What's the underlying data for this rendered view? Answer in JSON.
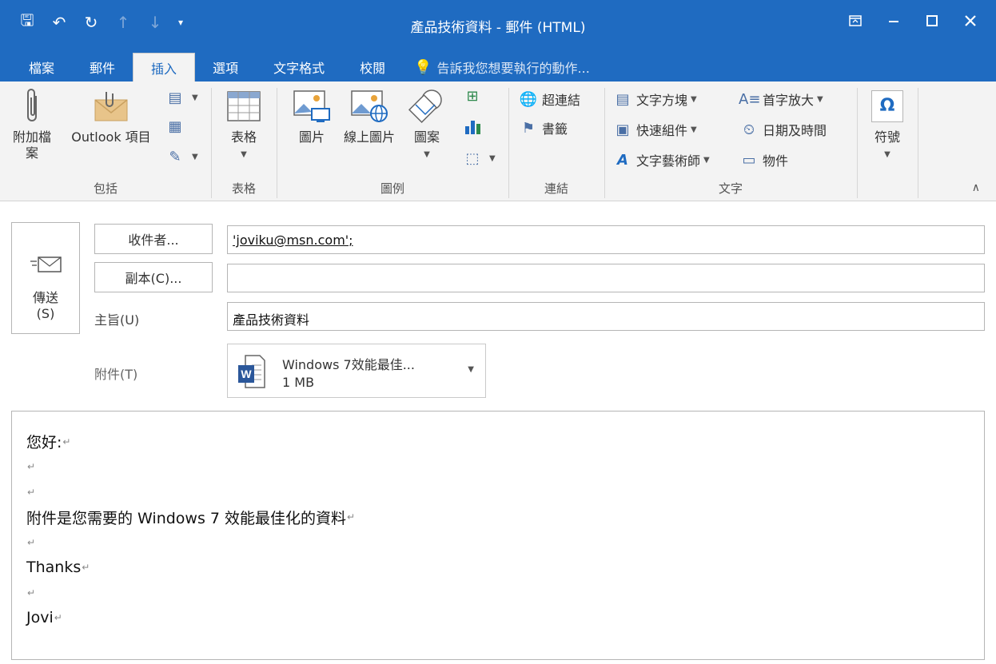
{
  "window": {
    "title": "產品技術資料 - 郵件 (HTML)"
  },
  "qat": {
    "save": "🖫",
    "undo": "↶",
    "redo": "↻",
    "up": "↑",
    "down": "↓",
    "customize": "▾"
  },
  "tabs": [
    {
      "label": "檔案"
    },
    {
      "label": "郵件"
    },
    {
      "label": "插入"
    },
    {
      "label": "選項"
    },
    {
      "label": "文字格式"
    },
    {
      "label": "校閱"
    }
  ],
  "tell_me": "告訴我您想要執行的動作...",
  "ribbon": {
    "include": {
      "label": "包括",
      "attach_file": "附加檔\n案",
      "outlook_item": "Outlook 項目"
    },
    "tables": {
      "label": "表格",
      "table": "表格"
    },
    "illustrations": {
      "label": "圖例",
      "pictures": "圖片",
      "online_pictures": "線上圖片",
      "shapes": "圖案"
    },
    "links": {
      "label": "連結",
      "hyperlink": "超連結",
      "bookmark": "書籤"
    },
    "text": {
      "label": "文字",
      "text_box": "文字方塊",
      "quick_parts": "快速組件",
      "wordart": "文字藝術師",
      "drop_cap": "首字放大",
      "date_time": "日期及時間",
      "object": "物件"
    },
    "symbols": {
      "symbol": "符號"
    }
  },
  "compose": {
    "send_label": "傳送",
    "send_key": "(S)",
    "to_button": "收件者...",
    "cc_button": "副本(C)...",
    "subject_label": "主旨(U)",
    "attachments_label": "附件(T)",
    "to_value": "'joviku@msn.com';",
    "cc_value": "",
    "subject_value": "產品技術資料",
    "attachment": {
      "name": "Windows 7效能最佳...",
      "size": "1 MB"
    }
  },
  "message_body": {
    "lines": [
      "您好:",
      "",
      "",
      "附件是您需要的 Windows 7 效能最佳化的資料",
      "",
      "Thanks",
      "",
      "Jovi"
    ],
    "paragraph_mark": "↵"
  },
  "colors": {
    "accent": "#1f6bc1",
    "ribbon_bg": "#f3f3f3"
  }
}
